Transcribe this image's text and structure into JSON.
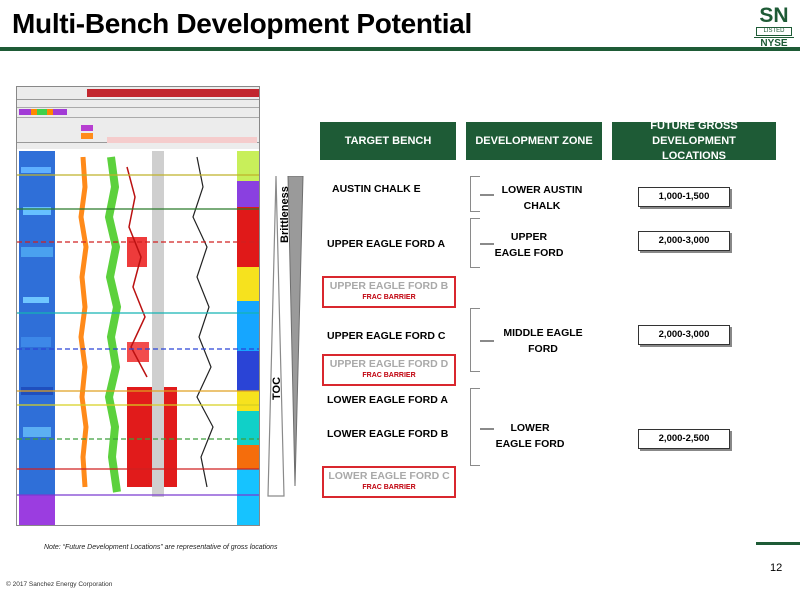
{
  "slide": {
    "title": "Multi-Bench Development Potential",
    "page_number": "12",
    "note": "Note: “Future Development Locations” are representative of gross locations",
    "copyright": "© 2017 Sanchez Energy Corporation"
  },
  "logo": {
    "letters": "SN",
    "listed": "LISTED",
    "exchange": "NYSE"
  },
  "wedges": {
    "brittleness_label": "Brittleness",
    "toc_label": "TOC"
  },
  "table": {
    "headers": {
      "target_bench": "TARGET BENCH",
      "development_zone": "DEVELOPMENT ZONE",
      "future_locations": "FUTURE GROSS DEVELOPMENT LOCATIONS"
    },
    "benches": [
      {
        "name": "AUSTIN CHALK E"
      },
      {
        "name": "UPPER EAGLE FORD A"
      },
      {
        "name": "UPPER EAGLE FORD B",
        "tag": "FRAC BARRIER"
      },
      {
        "name": "UPPER EAGLE FORD C"
      },
      {
        "name": "UPPER EAGLE FORD D",
        "tag": "FRAC BARRIER"
      },
      {
        "name": "LOWER EAGLE FORD A"
      },
      {
        "name": "LOWER EAGLE FORD B"
      },
      {
        "name": "LOWER EAGLE FORD C",
        "tag": "FRAC BARRIER"
      }
    ],
    "zones": [
      {
        "name": "LOWER AUSTIN CHALK",
        "locations": "1,000-1,500"
      },
      {
        "name": "UPPER EAGLE FORD",
        "locations": "2,000-3,000"
      },
      {
        "name": "MIDDLE EAGLE FORD",
        "locations": "2,000-3,000"
      },
      {
        "name": "LOWER EAGLE FORD",
        "locations": "2,000-2,500"
      }
    ]
  },
  "colors": {
    "brand_green": "#1e5b36",
    "barrier_red": "#d9272e",
    "barrier_text": "#a9a9a9"
  }
}
